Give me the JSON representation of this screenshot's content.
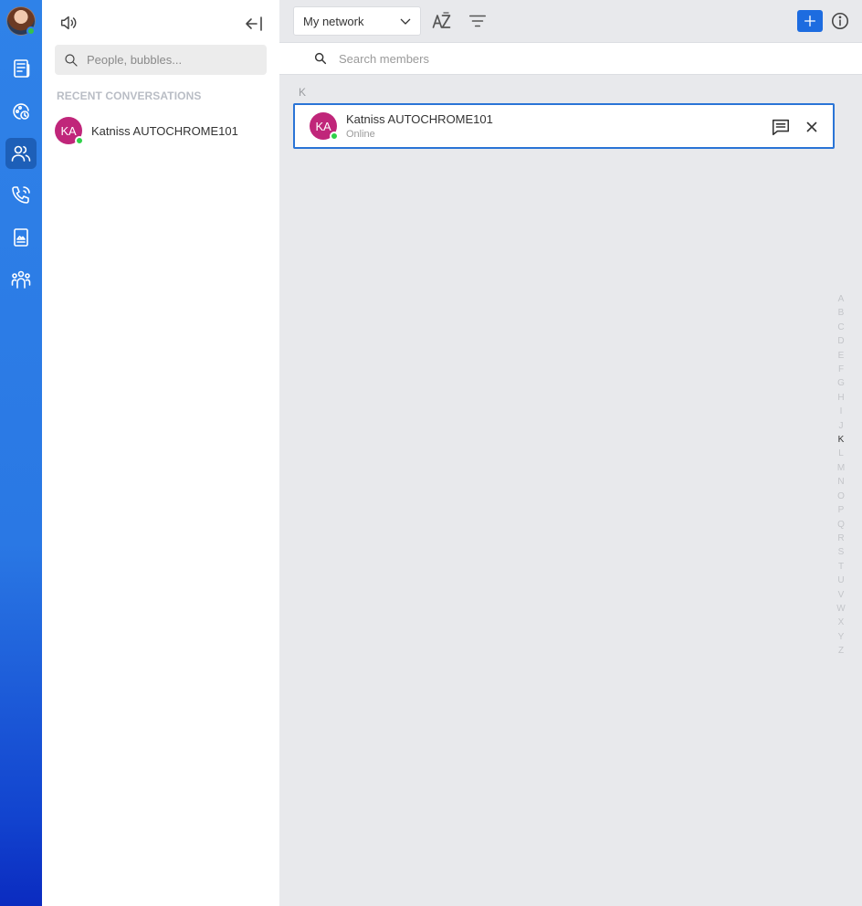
{
  "conversations": {
    "search_placeholder": "People, bubbles...",
    "section_title": "RECENT CONVERSATIONS",
    "items": [
      {
        "initials": "KA",
        "name": "Katniss AUTOCHROME101",
        "avatar_color": "#c0267a",
        "presence_color": "#2fd149"
      }
    ]
  },
  "rail": {
    "items": [
      "news-icon",
      "status-icon",
      "contacts-icon",
      "calls-icon",
      "files-icon",
      "bubbles-icon"
    ],
    "active": "contacts-icon"
  },
  "main": {
    "filter": {
      "selected": "My network"
    },
    "toolbar_icons": [
      "sort-az-icon",
      "filter-icon",
      "add-icon",
      "info-icon"
    ],
    "member_search_placeholder": "Search members",
    "group_letter": "K",
    "members": [
      {
        "initials": "KA",
        "name": "Katniss AUTOCHROME101",
        "status": "Online",
        "avatar_color": "#c0267a"
      }
    ],
    "alphabet": [
      "A",
      "B",
      "C",
      "D",
      "E",
      "F",
      "G",
      "H",
      "I",
      "J",
      "K",
      "L",
      "M",
      "N",
      "O",
      "P",
      "Q",
      "R",
      "S",
      "T",
      "U",
      "V",
      "W",
      "X",
      "Y",
      "Z"
    ],
    "alphabet_active": "K",
    "accent_color": "#1d6ce0"
  }
}
